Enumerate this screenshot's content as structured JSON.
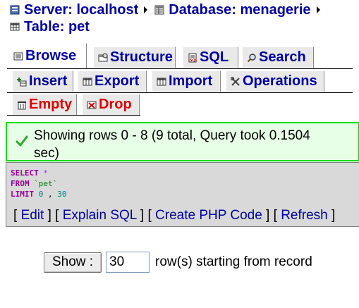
{
  "breadcrumb": {
    "server": "Server: localhost",
    "database": "Database: menagerie",
    "table": "Table: pet"
  },
  "tabs": {
    "browse": "Browse",
    "structure": "Structure",
    "sql": "SQL",
    "search": "Search",
    "insert": "Insert",
    "export": "Export",
    "import": "Import",
    "operations": "Operations",
    "empty": "Empty",
    "drop": "Drop"
  },
  "notice": {
    "line1": "Showing rows 0 - 8 (9 total, Query took 0.1504",
    "line2": "sec)"
  },
  "sql": {
    "select": "SELECT",
    "star": "*",
    "from": "FROM",
    "table": "`pet`",
    "limit": "LIMIT",
    "offset": "0",
    "comma": ",",
    "count": "30"
  },
  "sql_actions": {
    "edit": "Edit",
    "explain": "Explain SQL",
    "php": "Create PHP Code",
    "refresh": "Refresh"
  },
  "form": {
    "show_label": "Show :",
    "rows_value": "30",
    "rows_text": "row(s) starting from record"
  },
  "colors": {
    "link": "#0000a0",
    "danger": "#e00000",
    "notice_border": "#00dd00",
    "notice_bg": "#e6ffe6",
    "sql_bg": "#d9d9d9"
  }
}
